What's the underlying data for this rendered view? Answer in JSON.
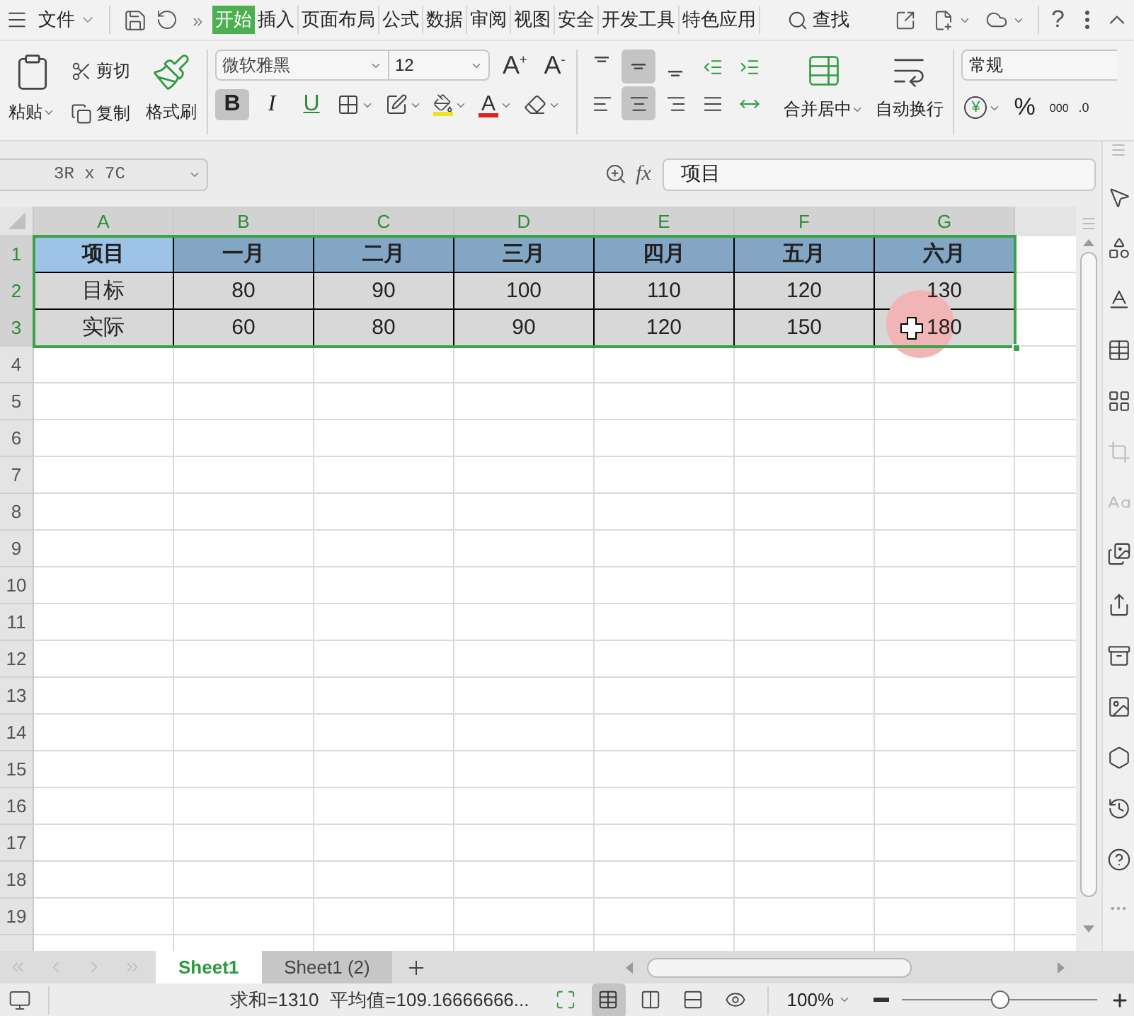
{
  "menu_bar": {
    "file_menu": "文件",
    "more": "»",
    "tabs": [
      {
        "label": "开始",
        "selected": true
      },
      {
        "label": "插入",
        "selected": false
      },
      {
        "label": "页面布局",
        "selected": false
      },
      {
        "label": "公式",
        "selected": false
      },
      {
        "label": "数据",
        "selected": false
      },
      {
        "label": "审阅",
        "selected": false
      },
      {
        "label": "视图",
        "selected": false
      },
      {
        "label": "安全",
        "selected": false
      },
      {
        "label": "开发工具",
        "selected": false
      },
      {
        "label": "特色应用",
        "selected": false
      }
    ],
    "search": "查找",
    "help": "?"
  },
  "ribbon": {
    "paste": "粘贴",
    "cut": "剪切",
    "copy": "复制",
    "format_painter": "格式刷",
    "font_name": "微软雅黑",
    "font_size": "12",
    "grow_font": "A$^{+}$",
    "shrink_font": "A$^{-}$",
    "styles": [
      {
        "label": "B",
        "kind": "bold",
        "selected": true
      },
      {
        "label": "I",
        "kind": "italic",
        "selected": false
      },
      {
        "label": "U",
        "kind": "underline",
        "selected": false
      }
    ],
    "font_color_letter": "A",
    "vertical_align": [
      {
        "kind": "top",
        "selected": false
      },
      {
        "kind": "middle",
        "selected": true
      },
      {
        "kind": "bottom",
        "selected": false
      }
    ],
    "horizontal_align": [
      {
        "kind": "left",
        "selected": false
      },
      {
        "kind": "center",
        "selected": true
      },
      {
        "kind": "right",
        "selected": false
      },
      {
        "kind": "justify",
        "selected": false
      }
    ],
    "merge": "合并居中",
    "wrap": "自动换行",
    "number_format": "常规",
    "currency": "¥",
    "percent": "%",
    "thousands": "000",
    "decimal": ".0"
  },
  "formula_bar": {
    "name_box": "3R x 7C",
    "fx": "fx",
    "value": "项目"
  },
  "sheet": {
    "columns": [
      {
        "label": "A",
        "selected": true
      },
      {
        "label": "B",
        "selected": true
      },
      {
        "label": "C",
        "selected": true
      },
      {
        "label": "D",
        "selected": true
      },
      {
        "label": "E",
        "selected": true
      },
      {
        "label": "F",
        "selected": true
      },
      {
        "label": "G",
        "selected": true
      }
    ],
    "rows": [
      {
        "label": "1",
        "selected": true,
        "cells": [
          {
            "text": "项目",
            "kind": "header",
            "active": true
          },
          {
            "text": "一月",
            "kind": "header",
            "active": false
          },
          {
            "text": "二月",
            "kind": "header",
            "active": false
          },
          {
            "text": "三月",
            "kind": "header",
            "active": false
          },
          {
            "text": "四月",
            "kind": "header",
            "active": false
          },
          {
            "text": "五月",
            "kind": "header",
            "active": false
          },
          {
            "text": "六月",
            "kind": "header",
            "active": false
          }
        ]
      },
      {
        "label": "2",
        "selected": true,
        "cells": [
          {
            "text": "目标",
            "kind": "value",
            "active": false
          },
          {
            "text": "80",
            "kind": "value",
            "active": false
          },
          {
            "text": "90",
            "kind": "value",
            "active": false
          },
          {
            "text": "100",
            "kind": "value",
            "active": false
          },
          {
            "text": "110",
            "kind": "value",
            "active": false
          },
          {
            "text": "120",
            "kind": "value",
            "active": false
          },
          {
            "text": "130",
            "kind": "value",
            "active": false
          }
        ]
      },
      {
        "label": "3",
        "selected": true,
        "cells": [
          {
            "text": "实际",
            "kind": "value",
            "active": false
          },
          {
            "text": "60",
            "kind": "value",
            "active": false
          },
          {
            "text": "80",
            "kind": "value",
            "active": false
          },
          {
            "text": "90",
            "kind": "value",
            "active": false
          },
          {
            "text": "120",
            "kind": "value",
            "active": false
          },
          {
            "text": "150",
            "kind": "value",
            "active": false
          },
          {
            "text": "180",
            "kind": "value",
            "active": false
          }
        ]
      },
      {
        "label": "4",
        "selected": false
      },
      {
        "label": "5",
        "selected": false
      },
      {
        "label": "6",
        "selected": false
      },
      {
        "label": "7",
        "selected": false
      },
      {
        "label": "8",
        "selected": false
      },
      {
        "label": "9",
        "selected": false
      },
      {
        "label": "10",
        "selected": false
      },
      {
        "label": "11",
        "selected": false
      },
      {
        "label": "12",
        "selected": false
      },
      {
        "label": "13",
        "selected": false
      },
      {
        "label": "14",
        "selected": false
      },
      {
        "label": "15",
        "selected": false
      },
      {
        "label": "16",
        "selected": false
      },
      {
        "label": "17",
        "selected": false
      },
      {
        "label": "18",
        "selected": false
      },
      {
        "label": "19",
        "selected": false
      }
    ]
  },
  "sheet_tabs": [
    {
      "label": "Sheet1",
      "selected": true
    },
    {
      "label": "Sheet1 (2)",
      "selected": false
    }
  ],
  "status_bar": {
    "sum": "求和=1310",
    "average": "平均值=109.16666666...",
    "view_modes": [
      {
        "kind": "fullscreen",
        "selected": false
      },
      {
        "kind": "normal",
        "selected": true
      },
      {
        "kind": "page_break",
        "selected": false
      },
      {
        "kind": "reading",
        "selected": false
      },
      {
        "kind": "eye",
        "selected": false
      }
    ],
    "zoom": "100%",
    "zoom_slider": {
      "level": 0.5
    }
  }
}
